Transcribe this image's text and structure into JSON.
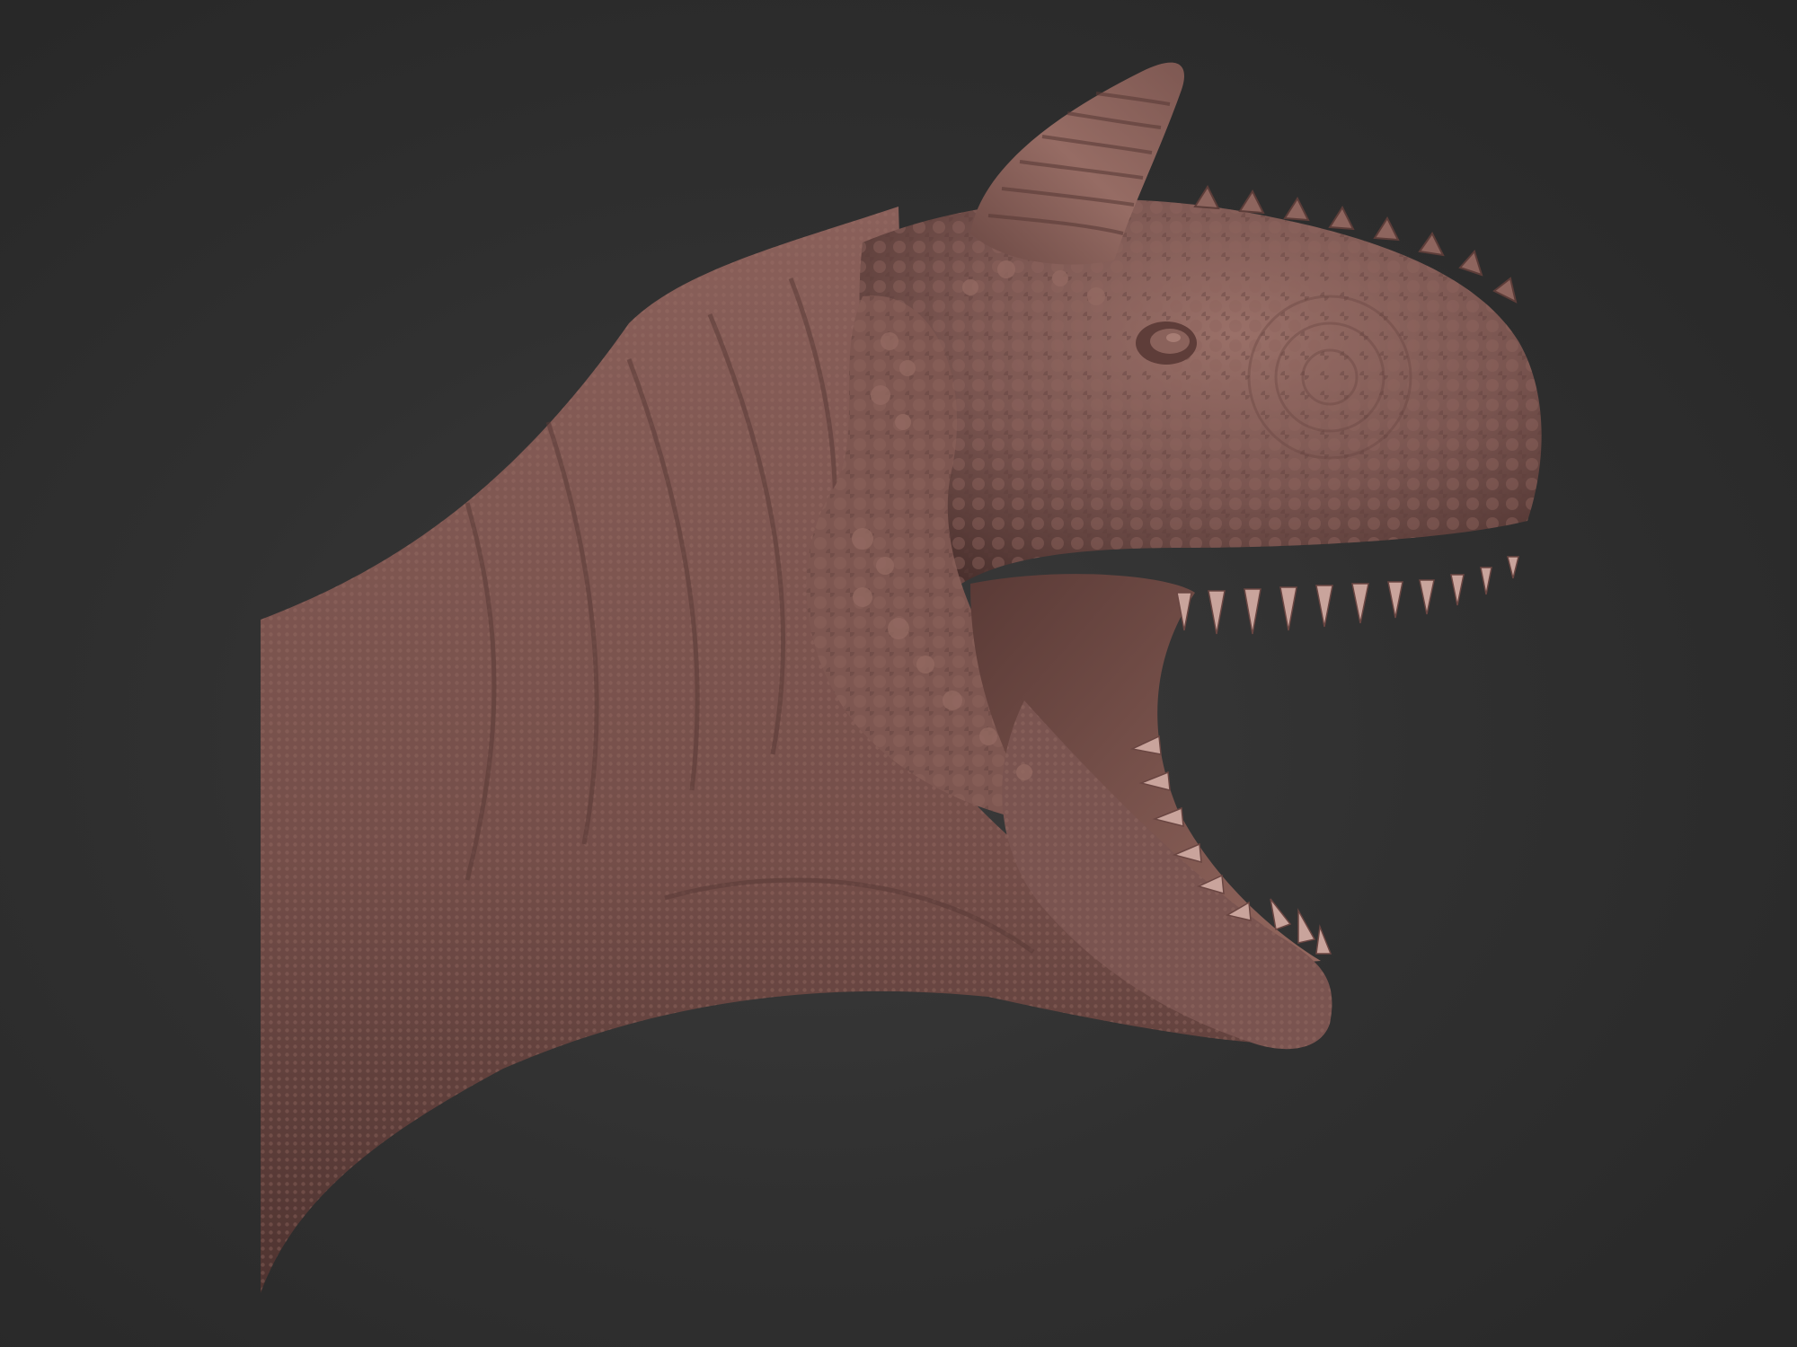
{
  "scene": {
    "subject": "sculpt-dinosaur-head",
    "background_color": "#2c2c2c",
    "skin_color": "#7a5550",
    "skin_highlight": "#9a7068",
    "skin_shadow": "#4a302d",
    "mouth_color": "#8c605a",
    "teeth_color": "#c9a49c"
  }
}
